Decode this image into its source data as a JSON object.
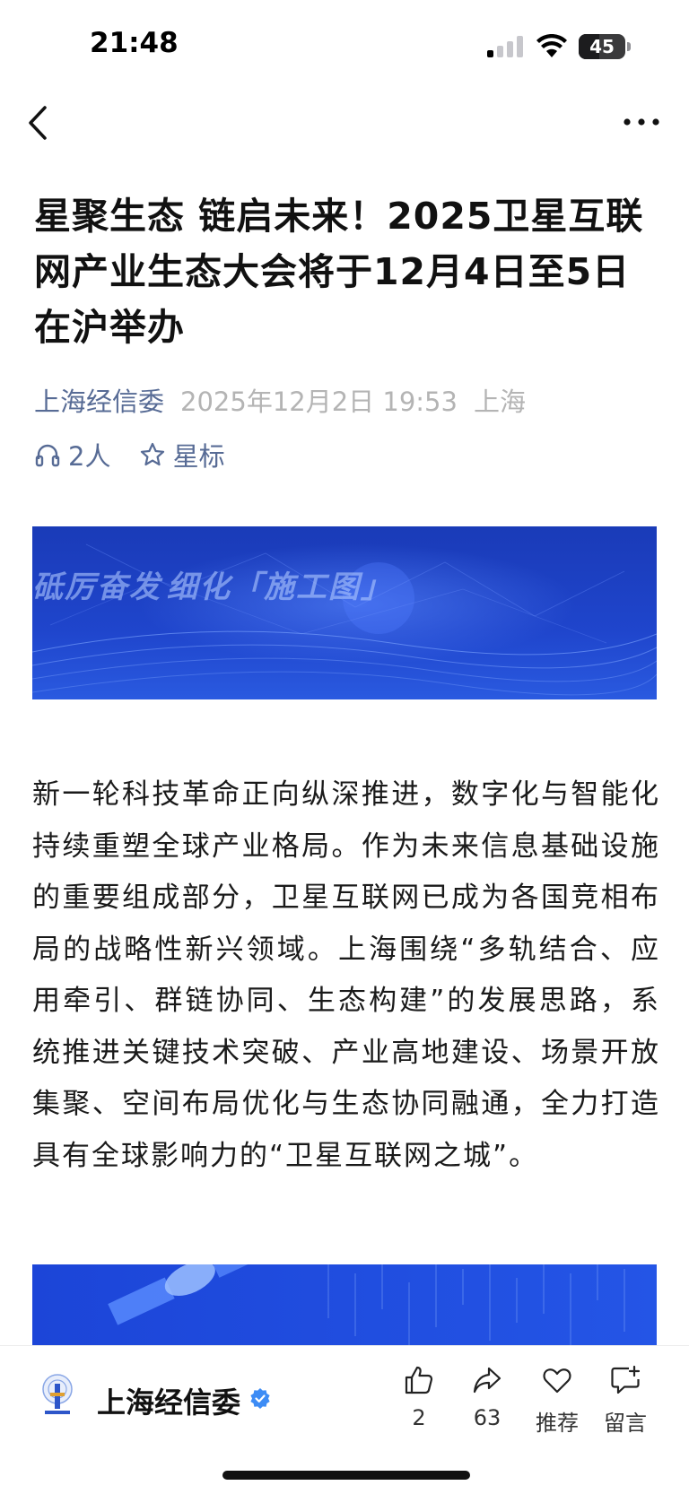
{
  "status_bar": {
    "time": "21:48",
    "battery": "45",
    "battery_level": 0.45
  },
  "nav": {
    "back_icon": "chevron-left-icon",
    "more_icon": "more-horizontal-icon"
  },
  "article": {
    "title": "星聚生态 链启未来！2025卫星互联网产业生态大会将于12月4日至5日在沪举办",
    "author": "上海经信委",
    "date": "2025年12月2日 19:53",
    "location": "上海",
    "listeners": "2人",
    "star_label": "星标",
    "banner": {
      "text_left": "砥厉奋发",
      "text_right": "细化「施工图」"
    },
    "body": "新一轮科技革命正向纵深推进，数字化与智能化持续重塑全球产业格局。作为未来信息基础设施的重要组成部分，卫星互联网已成为各国竞相布局的战略性新兴领域。上海围绕“多轨结合、应用牵引、群链协同、生态构建”的发展思路，系统推进关键技术突破、产业高地建设、场景开放集聚、空间布局优化与生态协同融通，全力打造具有全球影响力的“卫星互联网之城”。"
  },
  "bottom_bar": {
    "account_name": "上海经信委",
    "verified_color": "#3d8cf5",
    "actions": [
      {
        "icon": "thumbs-up-icon",
        "label": "2"
      },
      {
        "icon": "share-icon",
        "label": "63"
      },
      {
        "icon": "heart-icon",
        "label": "推荐"
      },
      {
        "icon": "comment-add-icon",
        "label": "留言"
      }
    ]
  },
  "colors": {
    "link": "#576b95",
    "meta_gray": "#b4b4b4",
    "banner_blue": "#1e3fc0"
  }
}
